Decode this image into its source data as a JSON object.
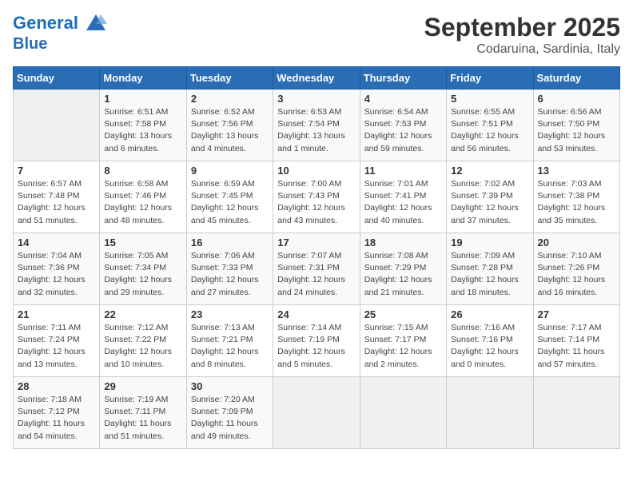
{
  "header": {
    "logo_line1": "General",
    "logo_line2": "Blue",
    "month": "September 2025",
    "location": "Codaruina, Sardinia, Italy"
  },
  "days_of_week": [
    "Sunday",
    "Monday",
    "Tuesday",
    "Wednesday",
    "Thursday",
    "Friday",
    "Saturday"
  ],
  "weeks": [
    [
      {
        "num": "",
        "info": ""
      },
      {
        "num": "1",
        "info": "Sunrise: 6:51 AM\nSunset: 7:58 PM\nDaylight: 13 hours\nand 6 minutes."
      },
      {
        "num": "2",
        "info": "Sunrise: 6:52 AM\nSunset: 7:56 PM\nDaylight: 13 hours\nand 4 minutes."
      },
      {
        "num": "3",
        "info": "Sunrise: 6:53 AM\nSunset: 7:54 PM\nDaylight: 13 hours\nand 1 minute."
      },
      {
        "num": "4",
        "info": "Sunrise: 6:54 AM\nSunset: 7:53 PM\nDaylight: 12 hours\nand 59 minutes."
      },
      {
        "num": "5",
        "info": "Sunrise: 6:55 AM\nSunset: 7:51 PM\nDaylight: 12 hours\nand 56 minutes."
      },
      {
        "num": "6",
        "info": "Sunrise: 6:56 AM\nSunset: 7:50 PM\nDaylight: 12 hours\nand 53 minutes."
      }
    ],
    [
      {
        "num": "7",
        "info": "Sunrise: 6:57 AM\nSunset: 7:48 PM\nDaylight: 12 hours\nand 51 minutes."
      },
      {
        "num": "8",
        "info": "Sunrise: 6:58 AM\nSunset: 7:46 PM\nDaylight: 12 hours\nand 48 minutes."
      },
      {
        "num": "9",
        "info": "Sunrise: 6:59 AM\nSunset: 7:45 PM\nDaylight: 12 hours\nand 45 minutes."
      },
      {
        "num": "10",
        "info": "Sunrise: 7:00 AM\nSunset: 7:43 PM\nDaylight: 12 hours\nand 43 minutes."
      },
      {
        "num": "11",
        "info": "Sunrise: 7:01 AM\nSunset: 7:41 PM\nDaylight: 12 hours\nand 40 minutes."
      },
      {
        "num": "12",
        "info": "Sunrise: 7:02 AM\nSunset: 7:39 PM\nDaylight: 12 hours\nand 37 minutes."
      },
      {
        "num": "13",
        "info": "Sunrise: 7:03 AM\nSunset: 7:38 PM\nDaylight: 12 hours\nand 35 minutes."
      }
    ],
    [
      {
        "num": "14",
        "info": "Sunrise: 7:04 AM\nSunset: 7:36 PM\nDaylight: 12 hours\nand 32 minutes."
      },
      {
        "num": "15",
        "info": "Sunrise: 7:05 AM\nSunset: 7:34 PM\nDaylight: 12 hours\nand 29 minutes."
      },
      {
        "num": "16",
        "info": "Sunrise: 7:06 AM\nSunset: 7:33 PM\nDaylight: 12 hours\nand 27 minutes."
      },
      {
        "num": "17",
        "info": "Sunrise: 7:07 AM\nSunset: 7:31 PM\nDaylight: 12 hours\nand 24 minutes."
      },
      {
        "num": "18",
        "info": "Sunrise: 7:08 AM\nSunset: 7:29 PM\nDaylight: 12 hours\nand 21 minutes."
      },
      {
        "num": "19",
        "info": "Sunrise: 7:09 AM\nSunset: 7:28 PM\nDaylight: 12 hours\nand 18 minutes."
      },
      {
        "num": "20",
        "info": "Sunrise: 7:10 AM\nSunset: 7:26 PM\nDaylight: 12 hours\nand 16 minutes."
      }
    ],
    [
      {
        "num": "21",
        "info": "Sunrise: 7:11 AM\nSunset: 7:24 PM\nDaylight: 12 hours\nand 13 minutes."
      },
      {
        "num": "22",
        "info": "Sunrise: 7:12 AM\nSunset: 7:22 PM\nDaylight: 12 hours\nand 10 minutes."
      },
      {
        "num": "23",
        "info": "Sunrise: 7:13 AM\nSunset: 7:21 PM\nDaylight: 12 hours\nand 8 minutes."
      },
      {
        "num": "24",
        "info": "Sunrise: 7:14 AM\nSunset: 7:19 PM\nDaylight: 12 hours\nand 5 minutes."
      },
      {
        "num": "25",
        "info": "Sunrise: 7:15 AM\nSunset: 7:17 PM\nDaylight: 12 hours\nand 2 minutes."
      },
      {
        "num": "26",
        "info": "Sunrise: 7:16 AM\nSunset: 7:16 PM\nDaylight: 12 hours\nand 0 minutes."
      },
      {
        "num": "27",
        "info": "Sunrise: 7:17 AM\nSunset: 7:14 PM\nDaylight: 11 hours\nand 57 minutes."
      }
    ],
    [
      {
        "num": "28",
        "info": "Sunrise: 7:18 AM\nSunset: 7:12 PM\nDaylight: 11 hours\nand 54 minutes."
      },
      {
        "num": "29",
        "info": "Sunrise: 7:19 AM\nSunset: 7:11 PM\nDaylight: 11 hours\nand 51 minutes."
      },
      {
        "num": "30",
        "info": "Sunrise: 7:20 AM\nSunset: 7:09 PM\nDaylight: 11 hours\nand 49 minutes."
      },
      {
        "num": "",
        "info": ""
      },
      {
        "num": "",
        "info": ""
      },
      {
        "num": "",
        "info": ""
      },
      {
        "num": "",
        "info": ""
      }
    ]
  ]
}
